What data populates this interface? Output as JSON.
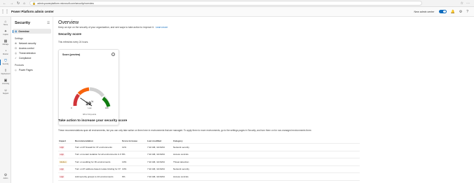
{
  "browser": {
    "url": "admin.powerplatform.microsoft.com/security/overview",
    "nav_icons": [
      "back-icon",
      "forward-icon",
      "refresh-icon",
      "home-icon"
    ]
  },
  "appbar": {
    "title": "Power Platform admin center",
    "new_admin_center_label": "New admin center",
    "toggle_on": true
  },
  "rail": {
    "items": [
      {
        "label": "Home",
        "icon": "home-icon"
      },
      {
        "label": "Copilot",
        "icon": "copilot-icon"
      },
      {
        "label": "Manage",
        "icon": "manage-icon"
      },
      {
        "label": "Monitor",
        "icon": "monitor-icon"
      },
      {
        "label": "Security",
        "icon": "shield-icon",
        "active": true
      },
      {
        "label": "Deployment",
        "icon": "deployment-icon"
      },
      {
        "label": "Licensing",
        "icon": "licensing-icon"
      },
      {
        "label": "Support",
        "icon": "support-icon"
      }
    ],
    "bottom_label": "Admin"
  },
  "secnav": {
    "title": "Security",
    "overview": "Overview",
    "group_settings": "Settings",
    "items": [
      "Network security",
      "Access control",
      "Threat detection",
      "Compliance"
    ],
    "group_products": "Products",
    "products": [
      "Power Pages"
    ]
  },
  "main": {
    "title": "Overview",
    "description": "Keep an eye on the security of your organization, and see ways to take action to improve it.",
    "learn_more": "Learn more",
    "security_score_heading": "Security score",
    "refresh_note": "This refreshes every 24 hours.",
    "card": {
      "title": "Score (preview)",
      "percent": 19,
      "percent_suffix": "%",
      "level": "Low",
      "points_text": "9/6 of 34 points",
      "min_label": "0",
      "max_label": "100"
    },
    "take_action_heading": "Take action to increase your security score",
    "take_action_desc": "These recommendations span all environments, but you can only take action on them here in environments that are managed. To apply them to more environments, go to the settings pages in Security, and turn them on for non-managed environments there."
  },
  "table": {
    "headers": [
      "Impact",
      "Recommendation",
      "Score increase",
      "Last modified",
      "Category"
    ],
    "rows": [
      {
        "impact": "High",
        "recommendation": "Turn on IP firewall for 37 environments",
        "score": "11%",
        "modified": "7:22 AM, 11/16/24",
        "category": "Network security"
      },
      {
        "impact": "High",
        "recommendation": "Turn on tenant isolation for all environments in this tenant",
        "score": "8%",
        "modified": "7:22 AM, 11/16/24",
        "category": "Access controls"
      },
      {
        "impact": "Medium",
        "recommendation": "Turn on auditing for 36 environments",
        "score": "10%",
        "modified": "7:22 AM, 11/16/24",
        "category": "Threat detection"
      },
      {
        "impact": "High",
        "recommendation": "Turn on IP address-based cookie binding for 37 environments",
        "score": "10%",
        "modified": "7:22 AM, 11/16/24",
        "category": "Network security"
      },
      {
        "impact": "High",
        "recommendation": "Add security groups to 24 environments",
        "score": "9%",
        "modified": "7:22 AM, 11/16/24",
        "category": "Access controls"
      }
    ]
  }
}
